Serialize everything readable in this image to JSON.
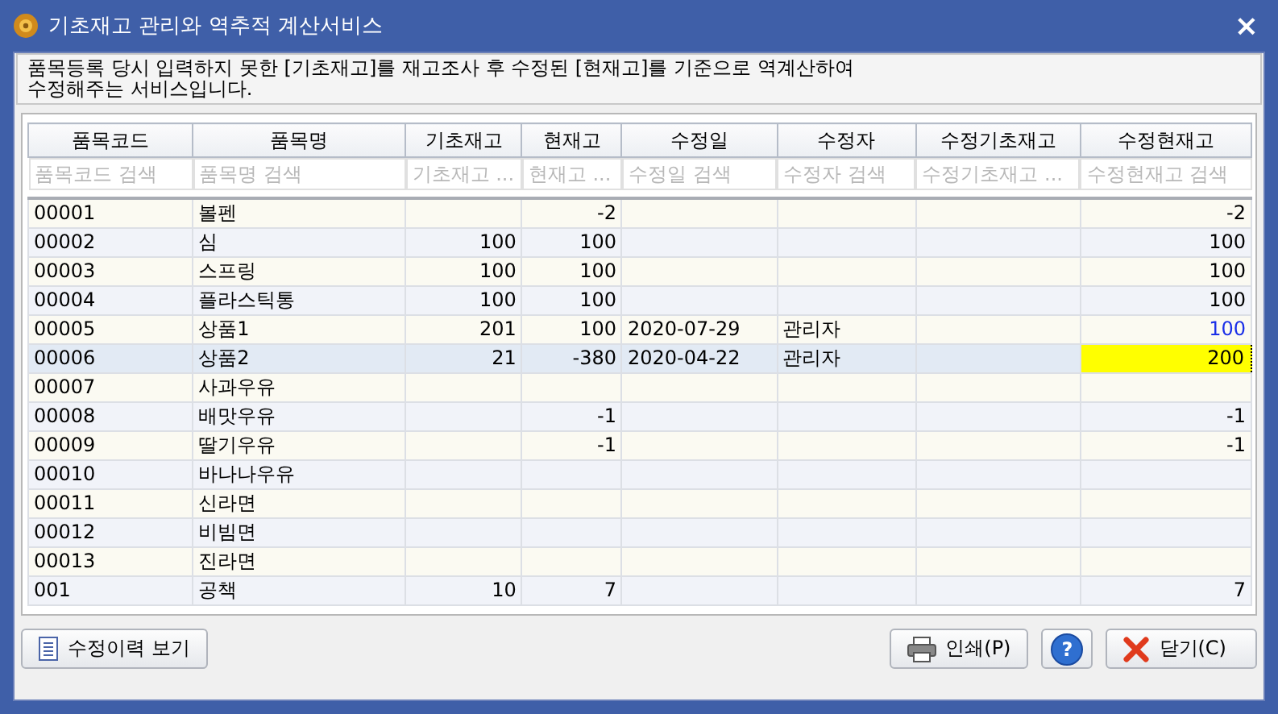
{
  "window": {
    "title": "기초재고 관리와 역추적 계산서비스",
    "close": "×"
  },
  "description": "품목등록 당시 입력하지 못한 [기초재고]를 재고조사 후 수정된 [현재고]를 기준으로 역계산하여 수정해주는 서비스입니다.",
  "table": {
    "columns": [
      {
        "label": "품목코드",
        "placeholder": "품목코드 검색"
      },
      {
        "label": "품목명",
        "placeholder": "품목명 검색"
      },
      {
        "label": "기초재고",
        "placeholder": "기초재고 ..."
      },
      {
        "label": "현재고",
        "placeholder": "현재고 ..."
      },
      {
        "label": "수정일",
        "placeholder": "수정일 검색"
      },
      {
        "label": "수정자",
        "placeholder": "수정자 검색"
      },
      {
        "label": "수정기초재고",
        "placeholder": "수정기초재고 ..."
      },
      {
        "label": "수정현재고",
        "placeholder": "수정현재고 검색"
      }
    ],
    "rows": [
      {
        "cells": [
          "00001",
          "볼펜",
          "",
          "-2",
          "",
          "",
          "",
          "-2"
        ],
        "selected": false,
        "edited": false,
        "focused": false
      },
      {
        "cells": [
          "00002",
          "심",
          "100",
          "100",
          "",
          "",
          "",
          "100"
        ],
        "selected": false,
        "edited": false,
        "focused": false
      },
      {
        "cells": [
          "00003",
          "스프링",
          "100",
          "100",
          "",
          "",
          "",
          "100"
        ],
        "selected": false,
        "edited": false,
        "focused": false
      },
      {
        "cells": [
          "00004",
          "플라스틱통",
          "100",
          "100",
          "",
          "",
          "",
          "100"
        ],
        "selected": false,
        "edited": false,
        "focused": false
      },
      {
        "cells": [
          "00005",
          "상품1",
          "201",
          "100",
          "2020-07-29",
          "관리자",
          "",
          "100"
        ],
        "selected": false,
        "edited": true,
        "focused": false
      },
      {
        "cells": [
          "00006",
          "상품2",
          "21",
          "-380",
          "2020-04-22",
          "관리자",
          "",
          "200"
        ],
        "selected": true,
        "edited": false,
        "focused": true
      },
      {
        "cells": [
          "00007",
          "사과우유"
        ],
        "selected": false,
        "focused": false
      },
      {
        "cells": [
          "00008",
          "배맛우유",
          "",
          "-1",
          "",
          "",
          "",
          "-1"
        ],
        "selected": false,
        "edited": false,
        "focused": false
      },
      {
        "cells": [
          "00009",
          "딸기우유",
          "",
          "-1",
          "",
          "",
          "",
          "-1"
        ],
        "selected": false,
        "edited": false,
        "focused": false
      },
      {
        "cells": [
          "00010",
          "바나나우유"
        ],
        "selected": false,
        "focused": false
      },
      {
        "cells": [
          "00011",
          "신라면"
        ],
        "selected": false,
        "focused": false
      },
      {
        "cells": [
          "00012",
          "비빔면"
        ],
        "selected": false,
        "focused": false
      },
      {
        "cells": [
          "00013",
          "진라면"
        ],
        "selected": false,
        "focused": false
      },
      {
        "cells": [
          "001",
          "공책",
          "10",
          "7",
          "",
          "",
          "",
          "7"
        ],
        "selected": false,
        "edited": false,
        "focused": false
      }
    ]
  },
  "buttons": {
    "history": "수정이력 보기",
    "print": "인쇄(P)",
    "help": "?",
    "close": "닫기(C)"
  }
}
